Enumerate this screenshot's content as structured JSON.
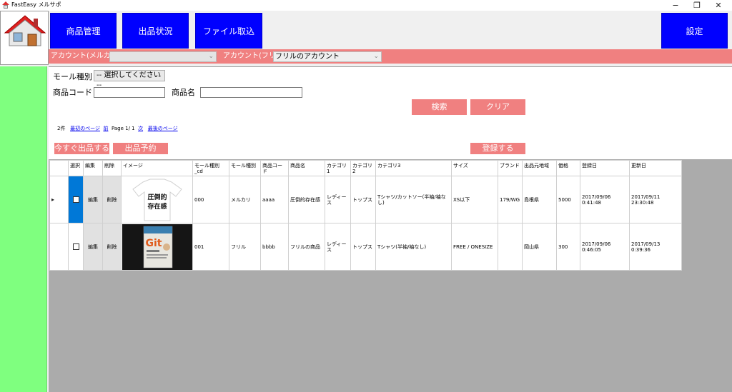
{
  "window": {
    "title": "FastEasy メルサポ",
    "minimize": "−",
    "maximize": "❐",
    "close": "✕"
  },
  "nav": {
    "product_mgmt": "商品管理",
    "listing_status": "出品状況",
    "file_import": "ファイル取込",
    "settings": "設定"
  },
  "accounts": {
    "mercari_label": "アカウント(メルカリ)",
    "mercari_value": "",
    "fril_label": "アカウント(フリル)",
    "fril_value": "フリルのアカウント"
  },
  "search": {
    "mall_label": "モール種別",
    "mall_value": "-- 選択してください --",
    "code_label": "商品コード",
    "code_value": "",
    "name_label": "商品名",
    "name_value": "",
    "search_button": "検索",
    "clear_button": "クリア"
  },
  "pager": {
    "count": "2件",
    "first": "最初のページ",
    "prev": "前",
    "page_info": "Page 1/ 1",
    "next": "次",
    "last": "最後のページ"
  },
  "actions": {
    "list_now": "今すぐ出品する",
    "schedule": "出品予約",
    "register": "登録する"
  },
  "table": {
    "headers": [
      "選択",
      "編集",
      "削除",
      "イメージ",
      "モール種別_cd",
      "モール種別",
      "商品コード",
      "商品名",
      "カテゴリ1",
      "カテゴリ2",
      "カテゴリ3",
      "サイズ",
      "ブランド",
      "出品元地域",
      "価格",
      "登録日",
      "更新日"
    ],
    "rows": [
      {
        "edit": "編集",
        "delete": "削除",
        "image_text": "圧倒的存在感",
        "mall_cd": "000",
        "mall": "メルカリ",
        "code": "aaaa",
        "name": "圧倒的存在感",
        "cat1": "レディース",
        "cat2": "トップス",
        "cat3": "Tシャツ/カットソー(半袖/袖なし)",
        "size": "XS以下",
        "brand": "179/WG",
        "region": "島根県",
        "price": "5000",
        "created": "2017/09/06 0:41:48",
        "updated": "2017/09/11 23:30:48"
      },
      {
        "edit": "編集",
        "delete": "削除",
        "image_text": "Git",
        "mall_cd": "001",
        "mall": "フリル",
        "code": "bbbb",
        "name": "フリルの商品",
        "cat1": "レディース",
        "cat2": "トップス",
        "cat3": "Tシャツ(半袖/袖なし)",
        "size": "FREE / ONESIZE",
        "brand": "",
        "region": "岡山県",
        "price": "300",
        "created": "2017/09/06 0:46:05",
        "updated": "2017/09/13 0:39:36"
      }
    ]
  },
  "colors": {
    "nav_blue": "#0000ff",
    "accent_pink": "#f08080",
    "sidebar_green": "#7fff7f",
    "grid_bg": "#ababab"
  }
}
